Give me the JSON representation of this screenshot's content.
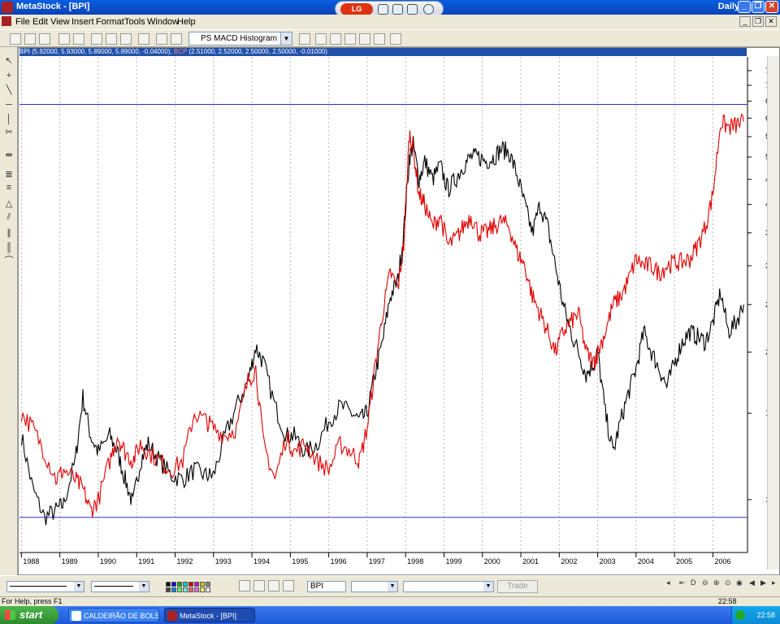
{
  "window": {
    "title": "MetaStock - [BPI]",
    "daily": "Daily",
    "minimize": "_",
    "restore": "❐",
    "close": "✕"
  },
  "lgbar": {
    "logo": "LG"
  },
  "menu": [
    "File",
    "Edit",
    "View",
    "Insert",
    "Format",
    "Tools",
    "Window",
    "Help"
  ],
  "toolbar": {
    "indicator_select": "PS MACD Histogram"
  },
  "chart": {
    "legend_bpi_symbol": "BPI",
    "legend_bpi_values": "(5.92000, 5.93000, 5.89000, 5.89000, -0.04000)",
    "legend_bcp_symbol": "BCP",
    "legend_bcp_values": "(2.51000, 2.52000, 2.50000, 2.50000, -0.01000)",
    "colors": {
      "bpi": "#000000",
      "bcp": "#e00000",
      "hlines": "#3030c0",
      "grid": "#b8b8b8"
    },
    "hline_levels": [
      6.4,
      0.92
    ]
  },
  "chart_data": {
    "type": "line",
    "title": "",
    "y_scale": "log",
    "ylim": [
      0.78,
      8.0
    ],
    "y_ticks": [
      "7.5",
      "7.0",
      "6.5",
      "6.0",
      "5.5",
      "5.0",
      "4.5",
      "4.0",
      "3.5",
      "3.0",
      "2.5",
      "2.0",
      "1.5",
      "1.0"
    ],
    "x_ticks": [
      "1988",
      "1989",
      "1990",
      "1991",
      "1992",
      "1993",
      "1994",
      "1995",
      "1996",
      "1997",
      "1998",
      "1999",
      "2000",
      "2001",
      "2002",
      "2003",
      "2004",
      "2005",
      "2006"
    ],
    "x_range": [
      1987.95,
      2006.9
    ],
    "series": [
      {
        "name": "BPI",
        "color": "#000000",
        "x": [
          1988.0,
          1988.3,
          1988.6,
          1988.9,
          1989.1,
          1989.4,
          1989.6,
          1989.8,
          1990.0,
          1990.3,
          1990.5,
          1990.7,
          1990.9,
          1991.1,
          1991.3,
          1991.6,
          1991.9,
          1992.2,
          1992.5,
          1992.8,
          1993.0,
          1993.3,
          1993.6,
          1993.9,
          1994.1,
          1994.3,
          1994.6,
          1994.9,
          1995.1,
          1995.4,
          1995.7,
          1996.0,
          1996.3,
          1996.6,
          1996.8,
          1997.0,
          1997.2,
          1997.4,
          1997.6,
          1997.8,
          1997.95,
          1998.1,
          1998.2,
          1998.35,
          1998.5,
          1998.7,
          1998.9,
          1999.1,
          1999.3,
          1999.5,
          1999.7,
          1999.9,
          2000.1,
          2000.3,
          2000.5,
          2000.7,
          2000.9,
          2001.1,
          2001.3,
          2001.5,
          2001.7,
          2001.9,
          2002.1,
          2002.3,
          2002.5,
          2002.7,
          2002.9,
          2003.0,
          2003.2,
          2003.4,
          2003.6,
          2003.8,
          2004.0,
          2004.2,
          2004.4,
          2004.6,
          2004.8,
          2005.0,
          2005.2,
          2005.4,
          2005.6,
          2005.8,
          2006.0,
          2006.2,
          2006.4,
          2006.6,
          2006.8
        ],
        "values": [
          1.35,
          1.05,
          0.92,
          0.95,
          0.98,
          1.2,
          1.62,
          1.35,
          1.25,
          1.35,
          1.25,
          1.1,
          0.98,
          1.2,
          1.3,
          1.2,
          1.12,
          1.1,
          1.15,
          1.12,
          1.12,
          1.35,
          1.55,
          1.75,
          2.05,
          1.9,
          1.55,
          1.35,
          1.35,
          1.25,
          1.3,
          1.45,
          1.55,
          1.5,
          1.45,
          1.5,
          1.8,
          2.1,
          2.6,
          2.8,
          3.5,
          5.0,
          5.3,
          4.5,
          4.9,
          4.5,
          4.8,
          4.3,
          4.5,
          4.8,
          5.0,
          5.0,
          4.9,
          5.0,
          5.2,
          5.1,
          4.6,
          4.0,
          3.5,
          4.0,
          3.6,
          3.0,
          2.5,
          2.2,
          2.0,
          1.8,
          1.9,
          2.0,
          1.5,
          1.25,
          1.45,
          1.65,
          1.85,
          2.2,
          2.0,
          1.85,
          1.7,
          1.9,
          2.1,
          2.2,
          2.15,
          2.1,
          2.3,
          2.65,
          2.2,
          2.3,
          2.5
        ]
      },
      {
        "name": "BCP",
        "color": "#e00000",
        "x": [
          1988.0,
          1988.3,
          1988.6,
          1988.9,
          1989.1,
          1989.4,
          1989.6,
          1989.8,
          1990.0,
          1990.3,
          1990.5,
          1990.7,
          1990.9,
          1991.1,
          1991.3,
          1991.6,
          1991.9,
          1992.2,
          1992.5,
          1992.8,
          1993.0,
          1993.3,
          1993.6,
          1993.9,
          1994.1,
          1994.3,
          1994.6,
          1994.9,
          1995.1,
          1995.4,
          1995.7,
          1996.0,
          1996.3,
          1996.6,
          1996.8,
          1997.0,
          1997.2,
          1997.4,
          1997.6,
          1997.8,
          1997.95,
          1998.1,
          1998.2,
          1998.35,
          1998.5,
          1998.7,
          1998.9,
          1999.1,
          1999.3,
          1999.5,
          1999.7,
          1999.9,
          2000.1,
          2000.3,
          2000.5,
          2000.7,
          2000.9,
          2001.1,
          2001.3,
          2001.5,
          2001.7,
          2001.9,
          2002.1,
          2002.3,
          2002.5,
          2002.7,
          2002.9,
          2003.0,
          2003.2,
          2003.4,
          2003.6,
          2003.8,
          2004.0,
          2004.2,
          2004.4,
          2004.6,
          2004.8,
          2005.0,
          2005.2,
          2005.4,
          2005.6,
          2005.8,
          2006.0,
          2006.2,
          2006.4,
          2006.6,
          2006.8
        ],
        "values": [
          1.5,
          1.4,
          1.25,
          1.1,
          1.15,
          1.1,
          1.05,
          0.95,
          1.0,
          1.2,
          1.35,
          1.25,
          1.2,
          1.3,
          1.25,
          1.2,
          1.15,
          1.2,
          1.5,
          1.45,
          1.4,
          1.35,
          1.4,
          1.75,
          1.85,
          1.3,
          1.1,
          1.35,
          1.25,
          1.3,
          1.2,
          1.15,
          1.3,
          1.25,
          1.2,
          1.4,
          1.85,
          2.4,
          2.9,
          2.7,
          3.3,
          5.6,
          5.2,
          4.2,
          4.0,
          3.6,
          3.8,
          3.3,
          3.4,
          3.6,
          3.8,
          3.5,
          3.5,
          3.6,
          3.7,
          3.6,
          3.2,
          3.0,
          2.6,
          2.4,
          2.2,
          2.0,
          2.2,
          2.3,
          2.4,
          2.0,
          1.9,
          2.0,
          2.2,
          2.5,
          2.6,
          2.8,
          3.1,
          3.0,
          3.0,
          2.9,
          3.0,
          3.05,
          3.05,
          3.1,
          3.3,
          3.6,
          4.2,
          5.9,
          5.75,
          5.8,
          5.9
        ]
      }
    ]
  },
  "bottombar": {
    "symbol": "BPI",
    "trade": "Trade"
  },
  "statusbar": {
    "help": "For Help, press F1",
    "clock": "22:58"
  },
  "taskbar": {
    "start": "start",
    "tasks": [
      "CALDEIRÃO DE BOLS...",
      "MetaStock - [BPI]"
    ],
    "clock": "22:58"
  }
}
